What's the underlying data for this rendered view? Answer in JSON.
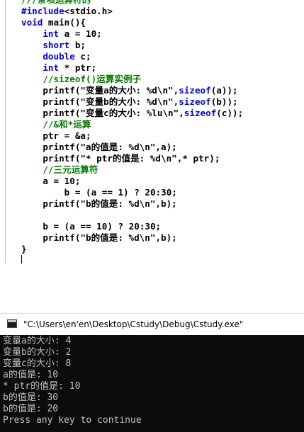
{
  "editor": {
    "lines": [
      {
        "parts": [
          {
            "t": "///条项运算符的",
            "c": "cm"
          }
        ]
      },
      {
        "parts": [
          {
            "t": "#include",
            "c": "pp"
          },
          {
            "t": "<stdio.h>",
            "c": "txt"
          }
        ]
      },
      {
        "parts": [
          {
            "t": "void",
            "c": "kw"
          },
          {
            "t": " main(){",
            "c": "txt"
          }
        ]
      },
      {
        "parts": [
          {
            "t": "    ",
            "c": "txt"
          },
          {
            "t": "int",
            "c": "kw"
          },
          {
            "t": " a = 10;",
            "c": "txt"
          }
        ]
      },
      {
        "parts": [
          {
            "t": "    ",
            "c": "txt"
          },
          {
            "t": "short",
            "c": "kw"
          },
          {
            "t": " b;",
            "c": "txt"
          }
        ]
      },
      {
        "parts": [
          {
            "t": "    ",
            "c": "txt"
          },
          {
            "t": "double",
            "c": "kw"
          },
          {
            "t": " c;",
            "c": "txt"
          }
        ]
      },
      {
        "parts": [
          {
            "t": "    ",
            "c": "txt"
          },
          {
            "t": "int",
            "c": "kw"
          },
          {
            "t": " * ptr;",
            "c": "txt"
          }
        ]
      },
      {
        "parts": [
          {
            "t": "    ",
            "c": "txt"
          },
          {
            "t": "//sizeof()运算实例子",
            "c": "cm"
          }
        ]
      },
      {
        "parts": [
          {
            "t": "    printf(\"变量a的大小: %d\\n\",",
            "c": "txt"
          },
          {
            "t": "sizeof",
            "c": "kw"
          },
          {
            "t": "(a));",
            "c": "txt"
          }
        ]
      },
      {
        "parts": [
          {
            "t": "    printf(\"变量b的大小: %d\\n\",",
            "c": "txt"
          },
          {
            "t": "sizeof",
            "c": "kw"
          },
          {
            "t": "(b));",
            "c": "txt"
          }
        ]
      },
      {
        "parts": [
          {
            "t": "    printf(\"变量c的大小: %lu\\n\",",
            "c": "txt"
          },
          {
            "t": "sizeof",
            "c": "kw"
          },
          {
            "t": "(c));",
            "c": "txt"
          }
        ]
      },
      {
        "parts": [
          {
            "t": "    ",
            "c": "txt"
          },
          {
            "t": "//&和*运算",
            "c": "cm"
          }
        ]
      },
      {
        "parts": [
          {
            "t": "    ptr = &a;",
            "c": "txt"
          }
        ]
      },
      {
        "parts": [
          {
            "t": "    printf(\"a的值是: %d\\n\",a);",
            "c": "txt"
          }
        ]
      },
      {
        "parts": [
          {
            "t": "    printf(\"* ptr的值是: %d\\n\",* ptr);",
            "c": "txt"
          }
        ]
      },
      {
        "parts": [
          {
            "t": "    ",
            "c": "txt"
          },
          {
            "t": "//三元运算符",
            "c": "cm"
          }
        ]
      },
      {
        "parts": [
          {
            "t": "    a = 10;",
            "c": "txt"
          }
        ]
      },
      {
        "parts": [
          {
            "t": "        b = (a == 1) ? 20:30;",
            "c": "txt"
          }
        ]
      },
      {
        "parts": [
          {
            "t": "    printf(\"b的值是: %d\\n\",b);",
            "c": "txt"
          }
        ]
      },
      {
        "parts": [
          {
            "t": "",
            "c": "txt"
          }
        ]
      },
      {
        "parts": [
          {
            "t": "    b = (a == 10) ? 20:30;",
            "c": "txt"
          }
        ]
      },
      {
        "parts": [
          {
            "t": "    printf(\"b的值是: %d\\n\",b);",
            "c": "txt"
          }
        ]
      },
      {
        "parts": [
          {
            "t": "}",
            "c": "txt"
          }
        ]
      }
    ]
  },
  "console": {
    "title": "\"C:\\Users\\en'en\\Desktop\\Cstudy\\Debug\\Cstudy.exe\"",
    "output": [
      "变量a的大小: 4",
      "变量b的大小: 2",
      "变量c的大小: 8",
      "a的值是: 10",
      "* ptr的值是: 10",
      "b的值是: 30",
      "b的值是: 20",
      "Press any key to continue"
    ]
  }
}
